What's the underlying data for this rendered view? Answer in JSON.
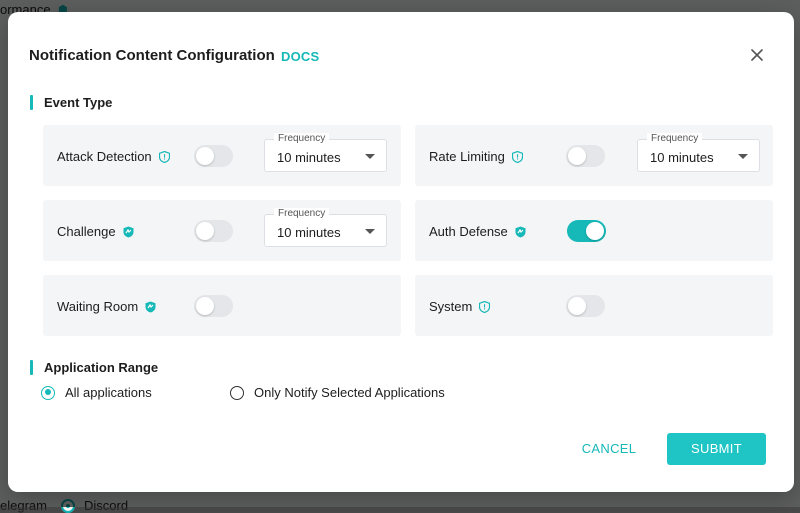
{
  "background_page": {
    "fragment_top": "ormance",
    "fragment_bottom_left": "elegram",
    "fragment_bottom_right": "Discord"
  },
  "modal": {
    "title": "Notification Content Configuration",
    "docs_label": "DOCS",
    "close_icon": "close-icon"
  },
  "event_type": {
    "heading": "Event Type",
    "frequency_label": "Frequency",
    "cards": [
      {
        "label": "Attack Detection",
        "icon": "shield-icon",
        "enabled": false,
        "frequency": "10 minutes"
      },
      {
        "label": "Rate Limiting",
        "icon": "shield-icon",
        "enabled": false,
        "frequency": "10 minutes"
      },
      {
        "label": "Challenge",
        "icon": "shield-icon",
        "enabled": false,
        "frequency": "10 minutes"
      },
      {
        "label": "Auth Defense",
        "icon": "shield-icon",
        "enabled": true
      },
      {
        "label": "Waiting Room",
        "icon": "shield-icon",
        "enabled": false
      },
      {
        "label": "System",
        "icon": "shield-icon",
        "enabled": false
      }
    ]
  },
  "application_range": {
    "heading": "Application Range",
    "options": [
      {
        "label": "All applications",
        "checked": true
      },
      {
        "label": "Only Notify Selected Applications",
        "checked": false
      }
    ]
  },
  "footer": {
    "cancel_label": "CANCEL",
    "submit_label": "SUBMIT"
  },
  "colors": {
    "accent": "#16b8b8",
    "submit_bg": "#1fc4c4",
    "card_bg": "#f4f5f6"
  }
}
